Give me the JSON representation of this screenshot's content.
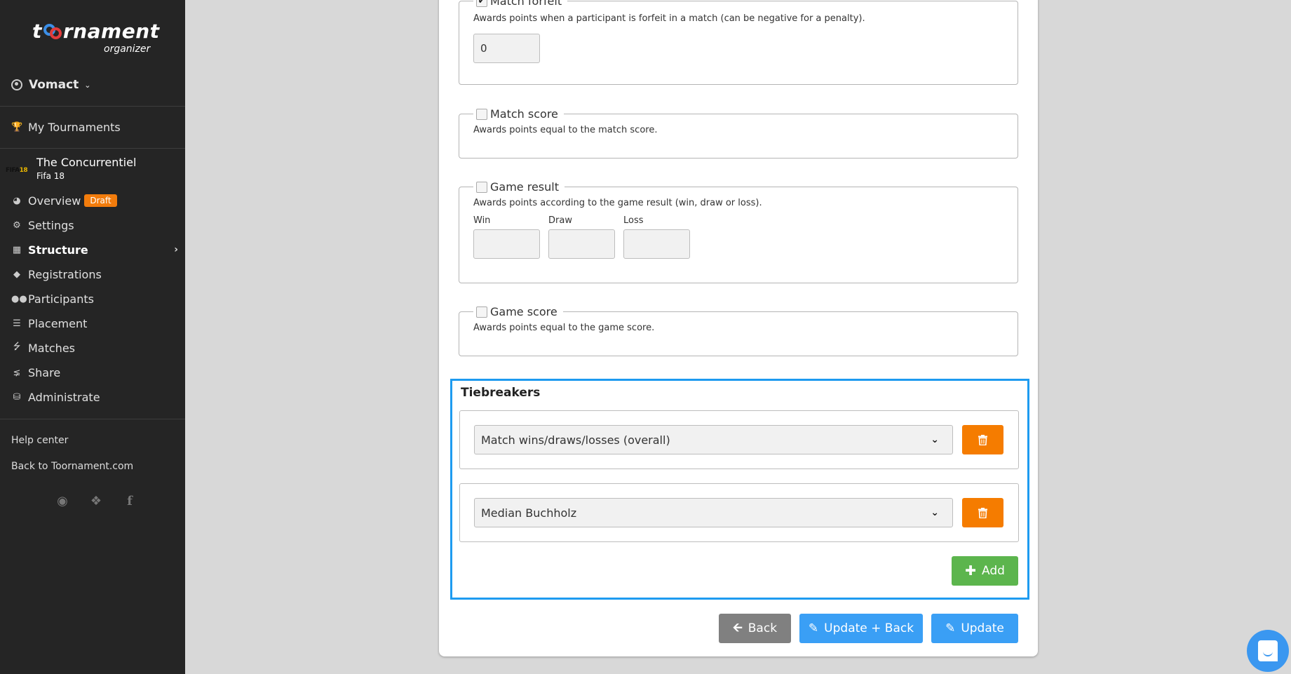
{
  "sidebar": {
    "logo": {
      "main_prefix": "t",
      "main_suffix": "rnament",
      "sub": "organizer"
    },
    "user": {
      "name": "Vomact"
    },
    "my_tournaments": "My Tournaments",
    "tournament": {
      "name": "The Concurrentiel",
      "game": "Fifa 18",
      "game_logo": "FIFA",
      "game_logo_num": "18"
    },
    "nav": [
      {
        "label": "Overview",
        "icon": "dashboard-icon",
        "badge": "Draft"
      },
      {
        "label": "Settings",
        "icon": "gears-icon"
      },
      {
        "label": "Structure",
        "icon": "grid-icon",
        "active": true
      },
      {
        "label": "Registrations",
        "icon": "ticket-icon"
      },
      {
        "label": "Participants",
        "icon": "users-icon"
      },
      {
        "label": "Placement",
        "icon": "ordered-list-icon"
      },
      {
        "label": "Matches",
        "icon": "bolt-icon"
      },
      {
        "label": "Share",
        "icon": "share-icon"
      },
      {
        "label": "Administrate",
        "icon": "database-icon"
      }
    ],
    "footer": {
      "help": "Help center",
      "back": "Back to Toornament.com"
    },
    "socials": [
      "discord-icon",
      "twitter-icon",
      "facebook-icon"
    ]
  },
  "options": {
    "match_forfeit": {
      "label": "Match forfeit",
      "checked": true,
      "description": "Awards points when a participant is forfeit in a match (can be negative for a penalty).",
      "value": "0"
    },
    "match_score": {
      "label": "Match score",
      "checked": false,
      "description": "Awards points equal to the match score."
    },
    "game_result": {
      "label": "Game result",
      "checked": false,
      "description": "Awards points according to the game result (win, draw or loss).",
      "fields": [
        {
          "label": "Win",
          "value": ""
        },
        {
          "label": "Draw",
          "value": ""
        },
        {
          "label": "Loss",
          "value": ""
        }
      ]
    },
    "game_score": {
      "label": "Game score",
      "checked": false,
      "description": "Awards points equal to the game score."
    }
  },
  "tiebreakers": {
    "title": "Tiebreakers",
    "items": [
      {
        "value": "Match wins/draws/losses (overall)"
      },
      {
        "value": "Median Buchholz"
      }
    ],
    "add_label": "Add"
  },
  "actions": {
    "back": "Back",
    "update_back": "Update + Back",
    "update": "Update"
  },
  "colors": {
    "sidebar_bg": "#252525",
    "draft_badge": "#f27c0c",
    "highlight": "#1e9bf0",
    "delete": "#f57c00",
    "add": "#5cb54d",
    "primary": "#3a9ff5",
    "back": "#808080"
  }
}
